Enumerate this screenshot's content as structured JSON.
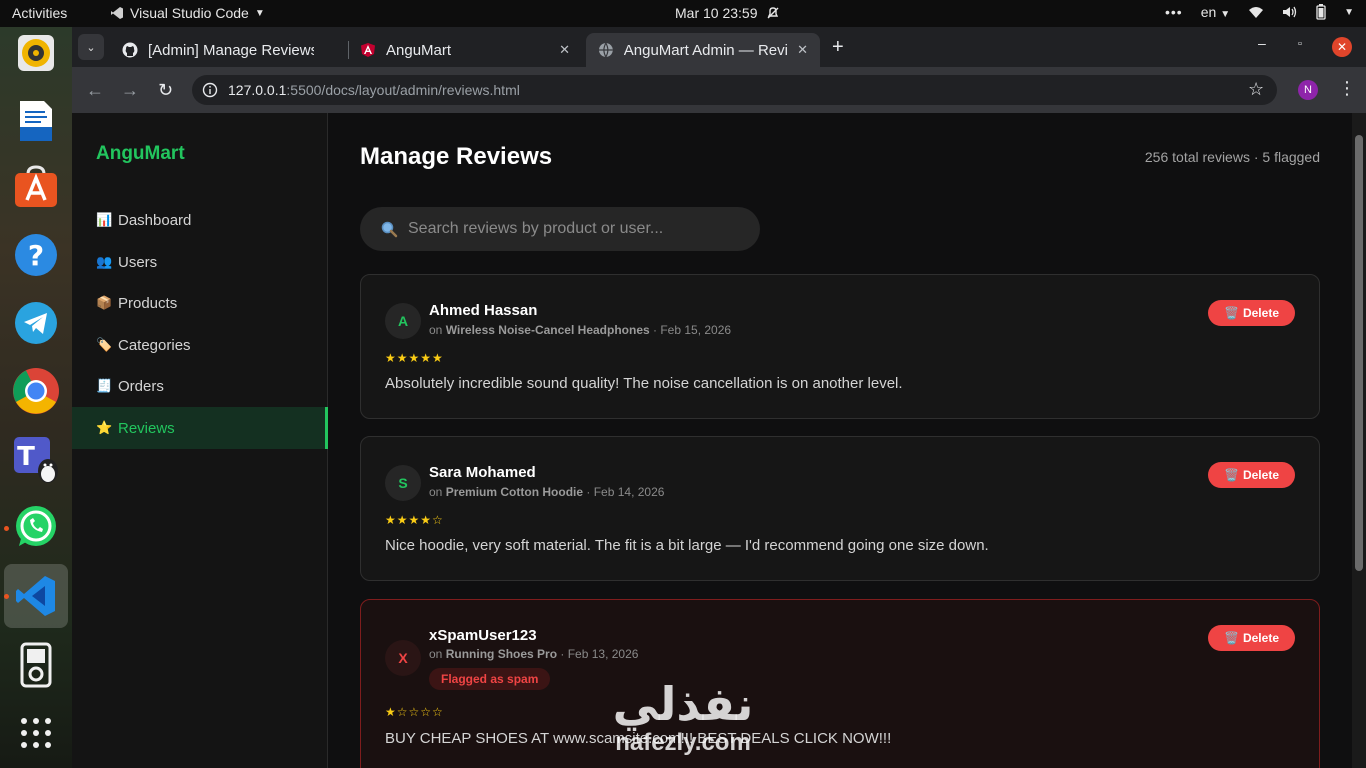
{
  "os": {
    "activities": "Activities",
    "app_name": "Visual Studio Code",
    "clock": "Mar 10  23:59",
    "lang": "en"
  },
  "browser": {
    "tabs": [
      {
        "title": "[Admin] Manage Reviews"
      },
      {
        "title": "AnguMart"
      },
      {
        "title": "AnguMart Admin — Reviews"
      }
    ],
    "url_host": "127.0.0.1",
    "url_path": ":5500/docs/layout/admin/reviews.html",
    "profile_initial": "N"
  },
  "sidebar": {
    "brand": "AnguMart",
    "items": [
      {
        "icon": "📊",
        "label": "Dashboard"
      },
      {
        "icon": "👥",
        "label": "Users"
      },
      {
        "icon": "📦",
        "label": "Products"
      },
      {
        "icon": "🏷️",
        "label": "Categories"
      },
      {
        "icon": "🧾",
        "label": "Orders"
      },
      {
        "icon": "⭐",
        "label": "Reviews"
      }
    ]
  },
  "main": {
    "title": "Manage Reviews",
    "summary": "256 total reviews · 5 flagged",
    "search_placeholder": "Search reviews by product or user..."
  },
  "reviews": [
    {
      "initial": "A",
      "user": "Ahmed Hassan",
      "on": "on",
      "product": "Wireless Noise-Cancel Headphones",
      "date": "· Feb 15, 2026",
      "stars": "★★★★★",
      "rating": 5,
      "text": "Absolutely incredible sound quality! The noise cancellation is on another level.",
      "delete": "Delete",
      "flagged": false
    },
    {
      "initial": "S",
      "user": "Sara Mohamed",
      "on": "on",
      "product": "Premium Cotton Hoodie",
      "date": "· Feb 14, 2026",
      "stars": "★★★★☆",
      "rating": 4,
      "text": "Nice hoodie, very soft material. The fit is a bit large — I'd recommend going one size down.",
      "delete": "Delete",
      "flagged": false
    },
    {
      "initial": "X",
      "user": "xSpamUser123",
      "on": "on",
      "product": "Running Shoes Pro",
      "date": "· Feb 13, 2026",
      "stars": "★☆☆☆☆",
      "rating": 1,
      "flag": "Flagged as spam",
      "text": "BUY CHEAP SHOES AT www.scamsite.com!!! BEST DEALS CLICK NOW!!!",
      "delete": "Delete",
      "flagged": true
    }
  ],
  "watermark": {
    "ar": "نفذلي",
    "en": "nafezly.com"
  },
  "colors": {
    "accent": "#22c55e",
    "danger": "#ef4444",
    "star": "#facc15"
  }
}
